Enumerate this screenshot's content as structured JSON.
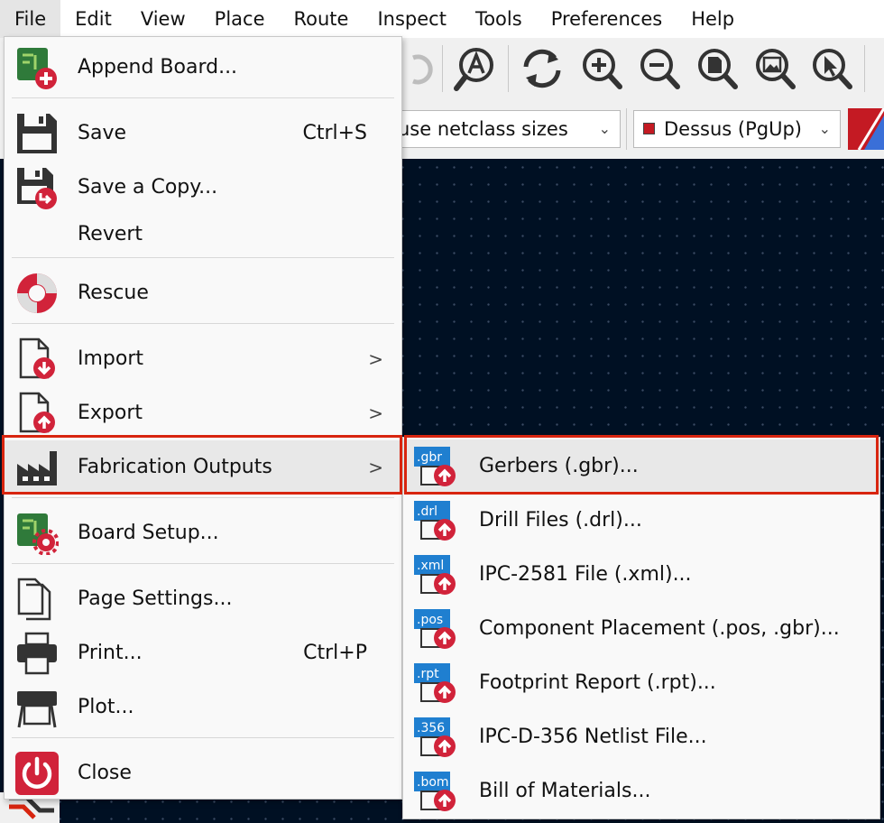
{
  "menubar": {
    "items": [
      {
        "label": "File"
      },
      {
        "label": "Edit"
      },
      {
        "label": "View"
      },
      {
        "label": "Place"
      },
      {
        "label": "Route"
      },
      {
        "label": "Inspect"
      },
      {
        "label": "Tools"
      },
      {
        "label": "Preferences"
      },
      {
        "label": "Help"
      }
    ]
  },
  "combobar": {
    "track_size": "use netclass sizes",
    "layer": "Dessus (PgUp)"
  },
  "file_menu": {
    "append_board": "Append Board...",
    "save": "Save",
    "save_shortcut": "Ctrl+S",
    "save_copy": "Save a Copy...",
    "revert": "Revert",
    "rescue": "Rescue",
    "import": "Import",
    "export": "Export",
    "fabrication_outputs": "Fabrication Outputs",
    "board_setup": "Board Setup...",
    "page_settings": "Page Settings...",
    "print": "Print...",
    "print_shortcut": "Ctrl+P",
    "plot": "Plot...",
    "close": "Close",
    "submenu_arrow": ">"
  },
  "fab_submenu": {
    "items": [
      {
        "badge": ".gbr",
        "label": "Gerbers (.gbr)..."
      },
      {
        "badge": ".drl",
        "label": "Drill Files (.drl)..."
      },
      {
        "badge": ".xml",
        "label": "IPC-2581 File (.xml)..."
      },
      {
        "badge": ".pos",
        "label": "Component Placement (.pos, .gbr)..."
      },
      {
        "badge": ".rpt",
        "label": "Footprint Report (.rpt)..."
      },
      {
        "badge": ".356",
        "label": "IPC-D-356 Netlist File..."
      },
      {
        "badge": ".bom",
        "label": "Bill of Materials..."
      }
    ]
  },
  "colors": {
    "accent_red": "#d8250f",
    "icon_red": "#d1233a",
    "badge_blue": "#1f7fd0",
    "canvas": "#001023",
    "board_green": "#2f7a3a"
  },
  "icons": {
    "toolbar": [
      "redo-icon",
      "search-text-icon",
      "refresh-icon",
      "zoom-in-icon",
      "zoom-out-icon",
      "zoom-page-icon",
      "zoom-fit-icon",
      "zoom-selection-icon"
    ]
  }
}
